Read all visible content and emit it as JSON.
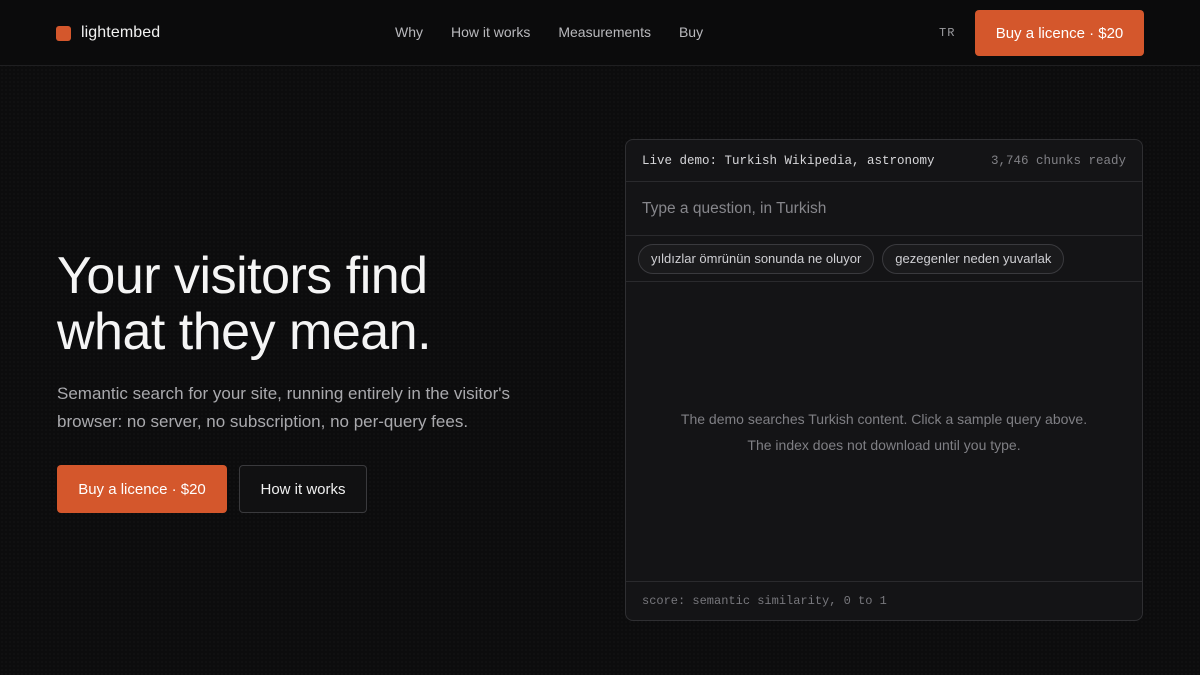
{
  "nav": {
    "brand": "lightembed",
    "links": [
      "Why",
      "How it works",
      "Measurements",
      "Buy"
    ],
    "lang": "TR",
    "cta": "Buy a licence · $20"
  },
  "hero": {
    "title_line1": "Your visitors find",
    "title_line2": "what they mean.",
    "subtitle": "Semantic search for your site, running entirely in the visitor's browser: no server, no subscription, no per-query fees.",
    "primary_cta": "Buy a licence · $20",
    "secondary_cta": "How it works"
  },
  "demo": {
    "title": "Live demo: Turkish Wikipedia, astronomy",
    "status": "3,746 chunks ready",
    "input_placeholder": "Type a question, in Turkish",
    "chips": [
      "yıldızlar ömrünün sonunda ne oluyor",
      "gezegenler neden yuvarlak"
    ],
    "message_line1": "The demo searches Turkish content. Click a sample query above.",
    "message_line2": "The index does not download until you type.",
    "footer": "score: semantic similarity, 0 to 1"
  },
  "colors": {
    "accent": "#d4572c",
    "background": "#0c0c0d",
    "panel": "#141416"
  }
}
